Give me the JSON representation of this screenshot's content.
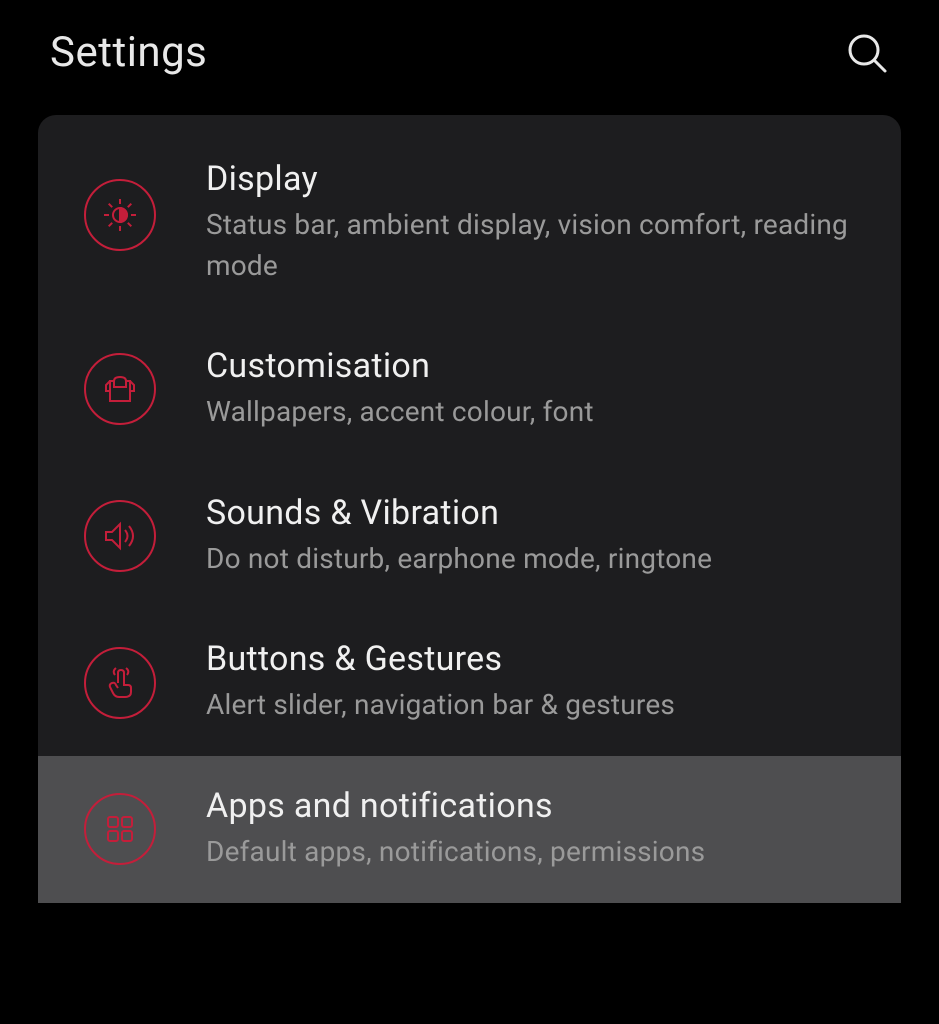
{
  "header": {
    "title": "Settings"
  },
  "items": [
    {
      "title": "Display",
      "desc": "Status bar, ambient display, vision comfort, reading mode"
    },
    {
      "title": "Customisation",
      "desc": "Wallpapers, accent colour, font"
    },
    {
      "title": "Sounds & Vibration",
      "desc": "Do not disturb, earphone mode, ringtone"
    },
    {
      "title": "Buttons & Gestures",
      "desc": "Alert slider, navigation bar & gestures"
    },
    {
      "title": "Apps and notifications",
      "desc": "Default apps, notifications, permissions"
    }
  ]
}
